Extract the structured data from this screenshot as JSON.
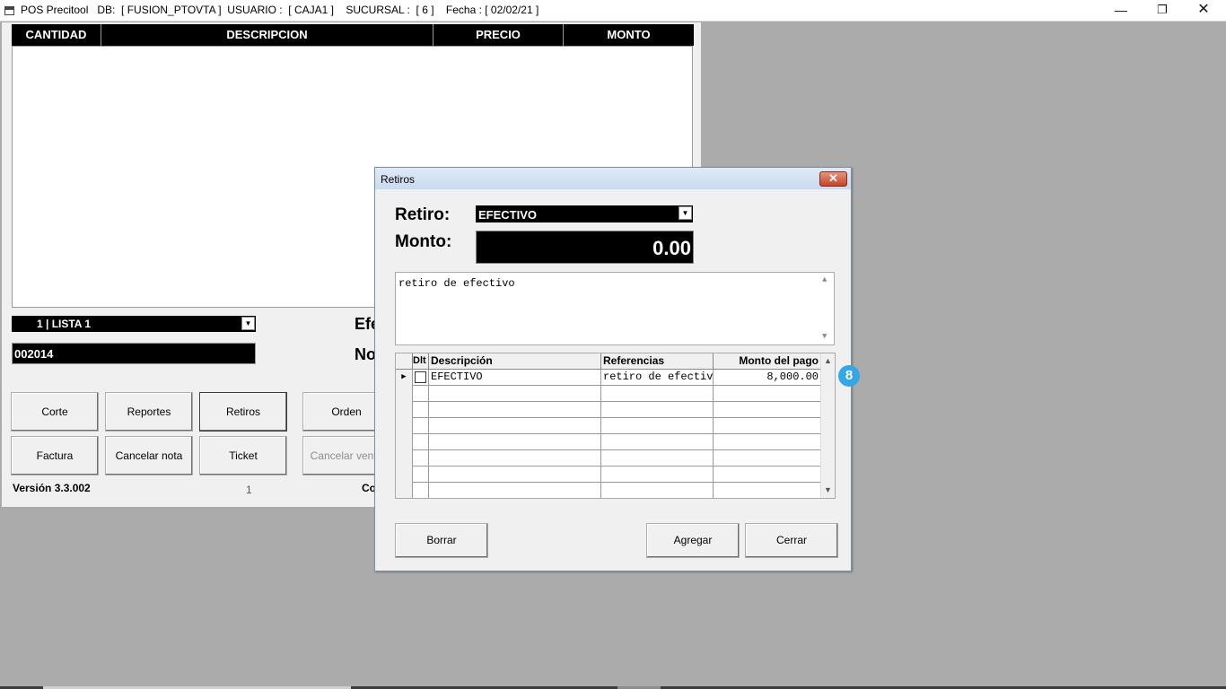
{
  "window": {
    "title": "POS Precitool   DB:  [ FUSION_PTOVTA ]  USUARIO :  [ CAJA1 ]    SUCURSAL :  [ 6 ]    Fecha : [ 02/02/21 ]",
    "minimize": "—",
    "maximize": "❐",
    "close": "✕"
  },
  "main": {
    "grid_columns": [
      "CANTIDAD",
      "DESCRIPCION",
      "PRECIO",
      "MONTO"
    ],
    "price_list": "1  | LISTA 1",
    "folio": "002014",
    "label_efectivo": "Efectivo",
    "label_nota": "Nota",
    "buttons": {
      "corte": "Corte",
      "reportes": "Reportes",
      "retiros": "Retiros",
      "orden": "Orden",
      "factura": "Factura",
      "cancelar_nota": "Cancelar nota",
      "ticket": "Ticket",
      "cancelar_venta": "Cancelar venta"
    },
    "version": "Versión 3.3.002",
    "count": "1",
    "footer_label": "Co"
  },
  "dialog": {
    "title": "Retiros",
    "close": "✕",
    "retiro_label": "Retiro:",
    "retiro_value": "EFECTIVO",
    "monto_label": "Monto:",
    "monto_value": "0.00",
    "notes": "retiro de efectivo",
    "grid": {
      "columns": [
        "Dlt",
        "Descripción",
        "Referencias",
        "Monto del pago"
      ],
      "rows": [
        {
          "descripcion": "EFECTIVO",
          "referencias": "retiro de efectivo",
          "monto": "8,000.00"
        }
      ]
    },
    "badge": "8",
    "buttons": {
      "borrar": "Borrar",
      "agregar": "Agregar",
      "cerrar": "Cerrar"
    }
  },
  "colors": {
    "desktop": "#ababab",
    "window": "#f0f0f0",
    "field_black": "#000000",
    "badge": "#35a6e8"
  }
}
